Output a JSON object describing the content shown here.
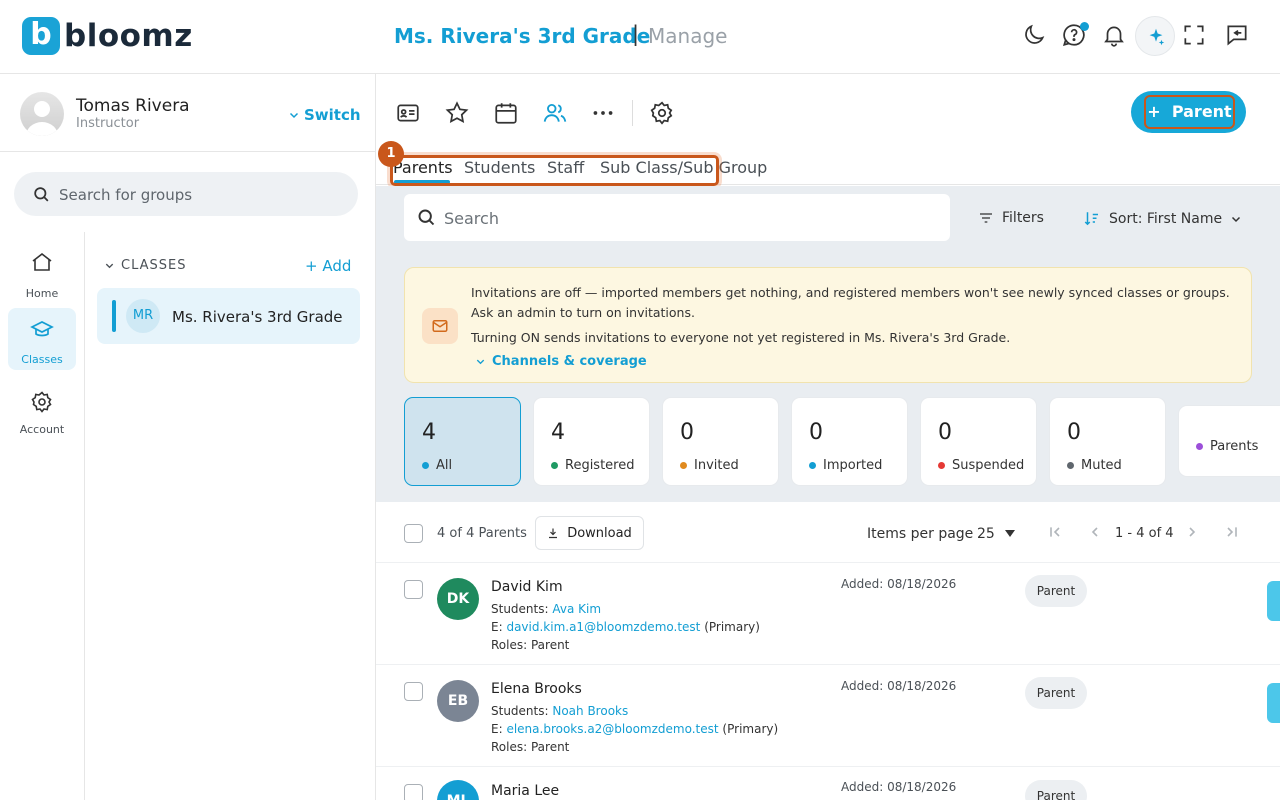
{
  "brand": {
    "logo_letter": "b",
    "name": "bloomz",
    "accent": "#139ed3"
  },
  "header": {
    "class_title": "Ms. Rivera's 3rd Grade",
    "separator": "|",
    "section": "Manage"
  },
  "user": {
    "name": "Tomas Rivera",
    "role": "Instructor",
    "switch_label": "Switch"
  },
  "sidebar": {
    "search_placeholder": "Search for groups",
    "rail": [
      {
        "label": "Home"
      },
      {
        "label": "Classes"
      },
      {
        "label": "Account"
      }
    ],
    "classes_header": "CLASSES",
    "add_label": "Add",
    "class_item": {
      "initials": "MR",
      "name": "Ms. Rivera's 3rd Grade"
    }
  },
  "toolbar": {
    "add_parent_label": "Parent"
  },
  "tabs": {
    "badge": "1",
    "items": [
      {
        "label": "Parents"
      },
      {
        "label": "Students"
      },
      {
        "label": "Staff"
      },
      {
        "label": "Sub Class/Sub Group"
      }
    ]
  },
  "filters": {
    "search_placeholder": "Search",
    "filters_label": "Filters",
    "sort_label": "Sort: First Name"
  },
  "notice": {
    "line1": "Invitations are off — imported members get nothing, and registered members won't see newly synced classes or groups.",
    "line2": "Ask an admin to turn on invitations.",
    "line3": "Turning ON sends invitations to everyone not yet registered in Ms. Rivera's 3rd Grade.",
    "channels_label": "Channels & coverage"
  },
  "stats": [
    {
      "count": "4",
      "label": "All",
      "color": "#139ed3"
    },
    {
      "count": "4",
      "label": "Registered",
      "color": "#1f9a63"
    },
    {
      "count": "0",
      "label": "Invited",
      "color": "#e08a1e"
    },
    {
      "count": "0",
      "label": "Imported",
      "color": "#139ed3"
    },
    {
      "count": "0",
      "label": "Suspended",
      "color": "#e53935"
    },
    {
      "count": "0",
      "label": "Muted",
      "color": "#5f666d"
    },
    {
      "count": "",
      "label": "Parents",
      "color": "#9c4fd9"
    }
  ],
  "list": {
    "count_text": "4 of 4 Parents",
    "download_label": "Download",
    "items_per_page_label": "Items per page",
    "items_per_page_value": "25",
    "range_text": "1 - 4 of 4",
    "rows": [
      {
        "initials": "DK",
        "avatar_color": "#1f8a5e",
        "name": "David Kim",
        "students_label": "Students: ",
        "student": "Ava Kim",
        "email_prefix": "E: ",
        "email": "david.kim.a1@bloomzdemo.test",
        "email_suffix": " (Primary)",
        "roles": "Roles: Parent",
        "added": "Added: 08/18/2026",
        "chip": "Parent"
      },
      {
        "initials": "EB",
        "avatar_color": "#7b8594",
        "name": "Elena Brooks",
        "students_label": "Students: ",
        "student": "Noah Brooks",
        "email_prefix": "E: ",
        "email": "elena.brooks.a2@bloomzdemo.test",
        "email_suffix": " (Primary)",
        "roles": "Roles: Parent",
        "added": "Added: 08/18/2026",
        "chip": "Parent"
      },
      {
        "initials": "ML",
        "avatar_color": "#139ed3",
        "name": "Maria Lee",
        "added": "Added: 08/18/2026",
        "chip": "Parent"
      }
    ]
  }
}
